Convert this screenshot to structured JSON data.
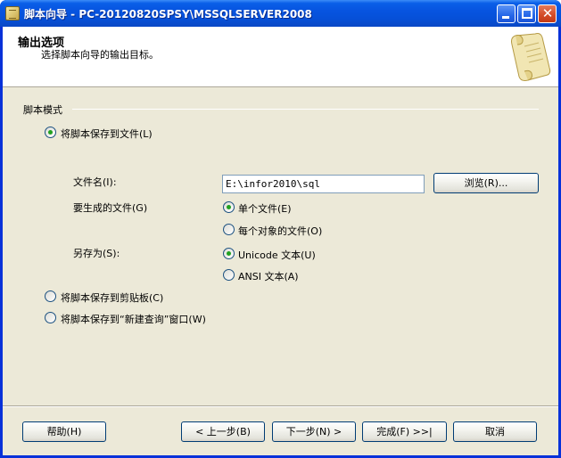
{
  "window": {
    "title": "脚本向导 - PC-20120820SPSY\\MSSQLSERVER2008",
    "close_glyph": "✕"
  },
  "header": {
    "title": "输出选项",
    "subtitle": "选择脚本向导的输出目标。"
  },
  "group": {
    "label": "脚本模式"
  },
  "options": {
    "save_to_file": "将脚本保存到文件(L)",
    "file_name_label": "文件名(I):",
    "file_name_value": "E:\\infor2010\\sql",
    "browse_button": "浏览(R)...",
    "files_to_generate_label": "要生成的文件(G)",
    "single_file": "单个文件(E)",
    "file_per_object": "每个对象的文件(O)",
    "save_as_label": "另存为(S):",
    "unicode_text": "Unicode 文本(U)",
    "ansi_text": "ANSI 文本(A)",
    "save_to_clipboard": "将脚本保存到剪贴板(C)",
    "save_to_new_query": "将脚本保存到“新建查询”窗口(W)"
  },
  "footer": {
    "help": "帮助(H)",
    "prev": "< 上一步(B)",
    "next": "下一步(N) >",
    "finish": "完成(F) >>|",
    "cancel": "取消"
  },
  "colors": {
    "titlebar": "#0754e0",
    "dialog_bg": "#ece9d8",
    "radio_dot": "#21a121"
  }
}
